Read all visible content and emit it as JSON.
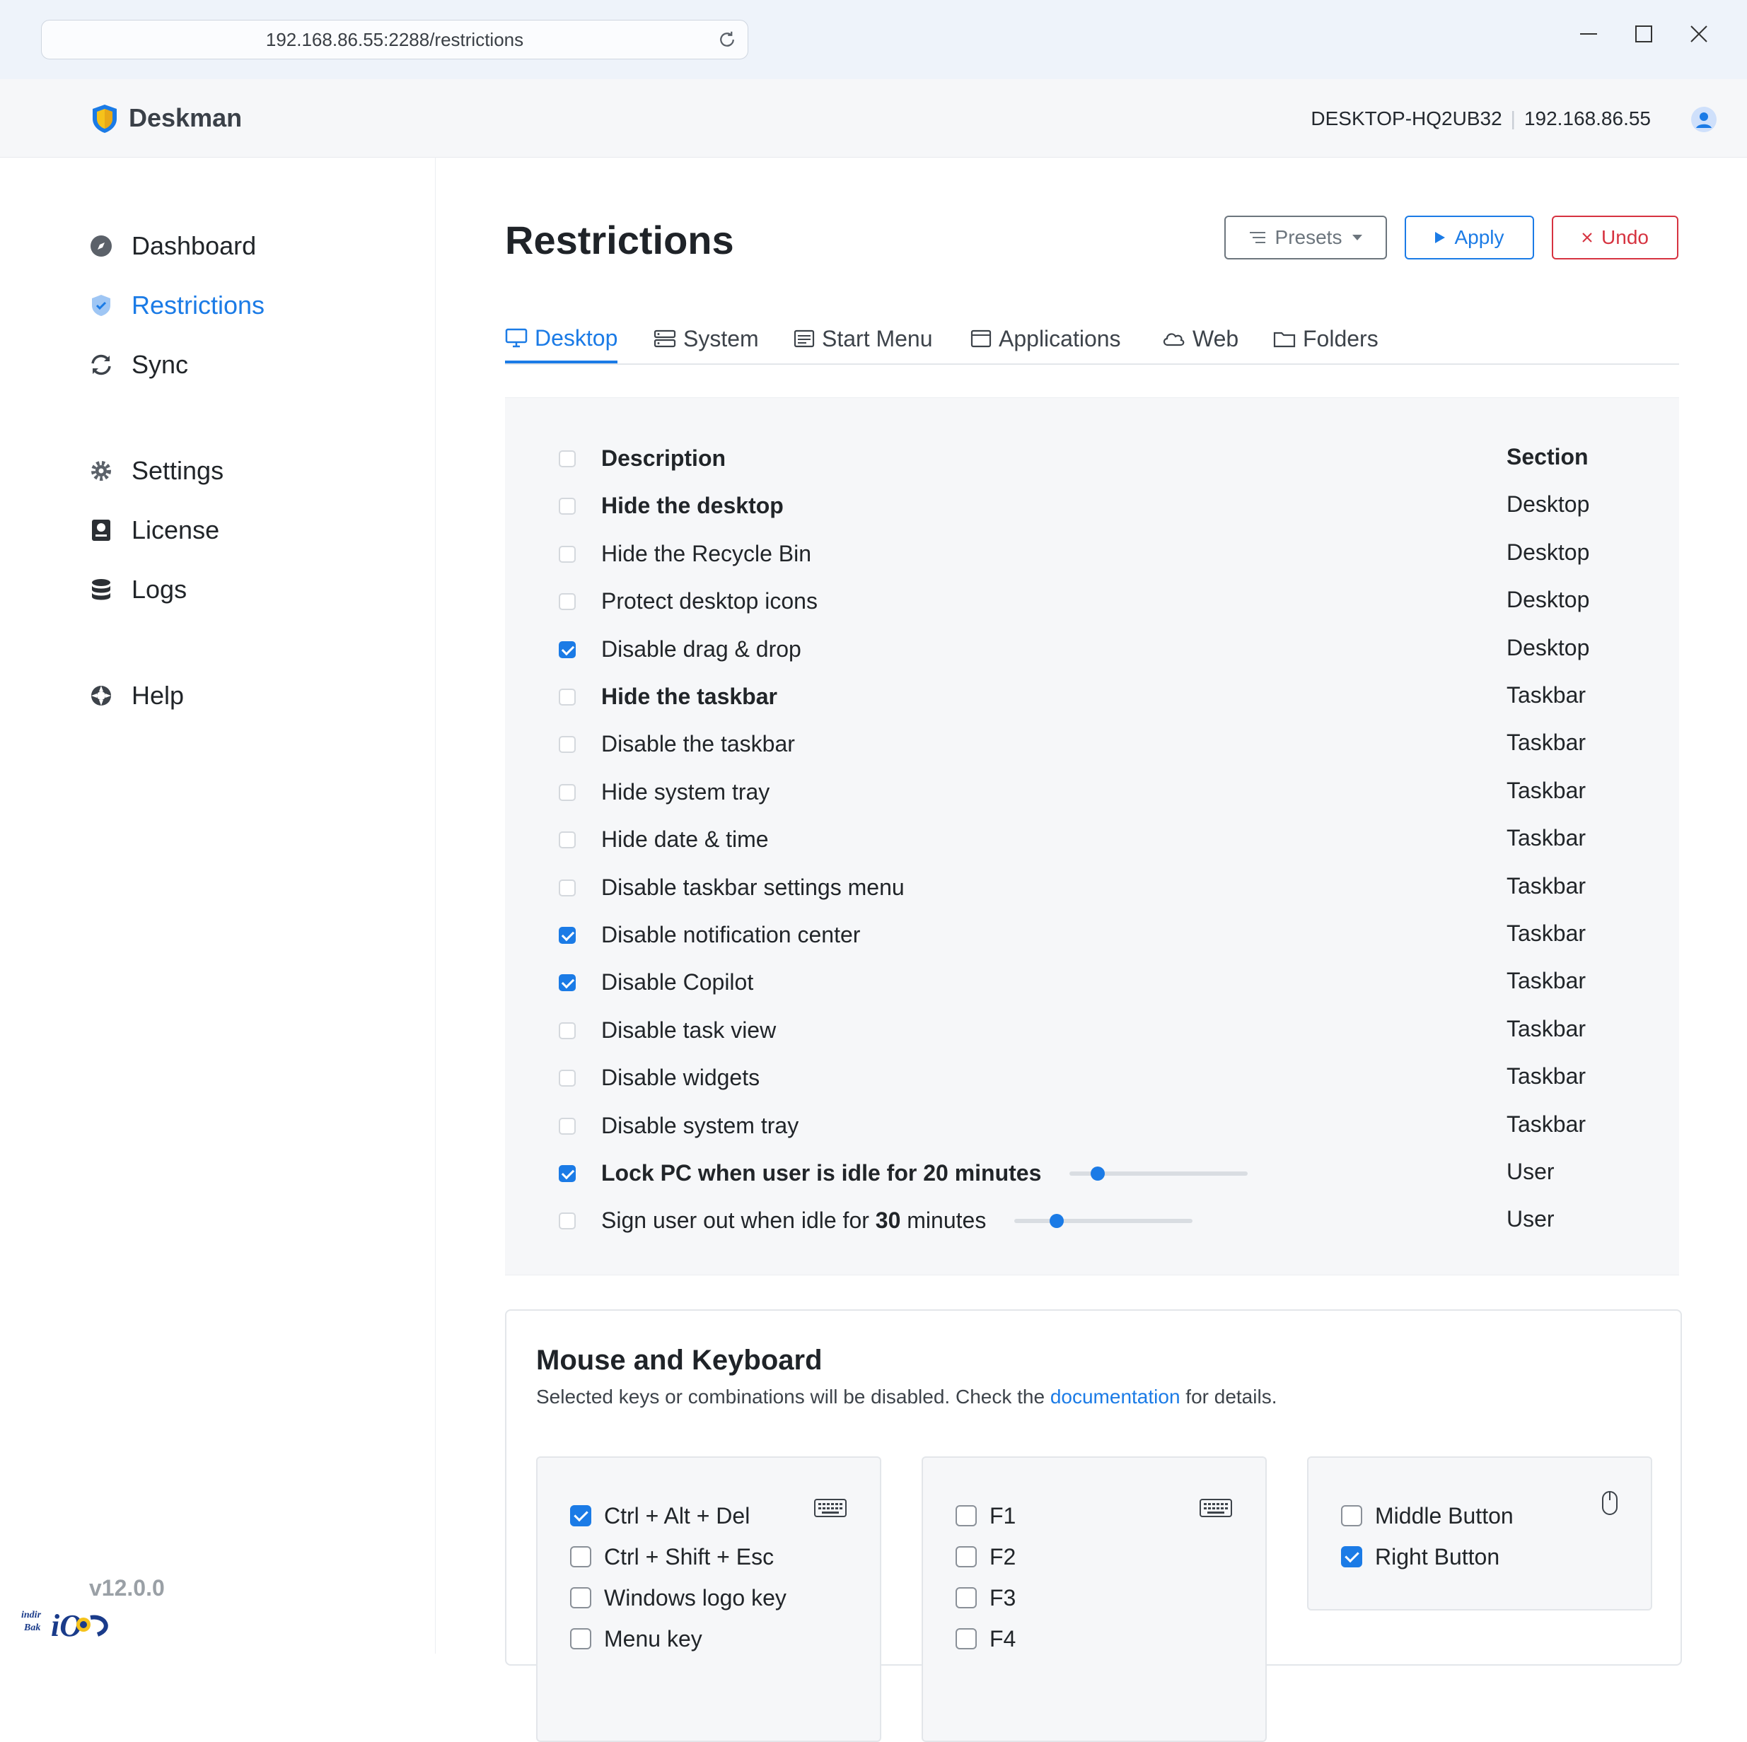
{
  "browser": {
    "url": "192.168.86.55:2288/restrictions"
  },
  "header": {
    "brand": "Deskman",
    "hostname": "DESKTOP-HQ2UB32",
    "ip": "192.168.86.55"
  },
  "sidebar": {
    "items": [
      {
        "label": "Dashboard",
        "icon": "compass-icon"
      },
      {
        "label": "Restrictions",
        "icon": "shield-check-icon",
        "active": true
      },
      {
        "label": "Sync",
        "icon": "sync-icon"
      },
      {
        "label": "Settings",
        "icon": "gear-icon"
      },
      {
        "label": "License",
        "icon": "license-icon"
      },
      {
        "label": "Logs",
        "icon": "database-icon"
      },
      {
        "label": "Help",
        "icon": "lifebuoy-icon"
      }
    ],
    "version": "v12.0.0"
  },
  "page": {
    "title": "Restrictions",
    "presets_label": "Presets",
    "apply_label": "Apply",
    "undo_label": "Undo"
  },
  "tabs": [
    {
      "label": "Desktop",
      "icon": "monitor-icon",
      "active": true
    },
    {
      "label": "System",
      "icon": "server-icon"
    },
    {
      "label": "Start Menu",
      "icon": "menu-window-icon"
    },
    {
      "label": "Applications",
      "icon": "window-icon"
    },
    {
      "label": "Web",
      "icon": "cloud-icon"
    },
    {
      "label": "Folders",
      "icon": "folder-icon"
    }
  ],
  "table": {
    "header": {
      "description": "Description",
      "section": "Section"
    },
    "rows": [
      {
        "description": "Hide the desktop",
        "section": "Desktop",
        "checked": false,
        "bold": true
      },
      {
        "description": "Hide the Recycle Bin",
        "section": "Desktop",
        "checked": false
      },
      {
        "description": "Protect desktop icons",
        "section": "Desktop",
        "checked": false
      },
      {
        "description": "Disable drag & drop",
        "section": "Desktop",
        "checked": true
      },
      {
        "description": "Hide the taskbar",
        "section": "Taskbar",
        "checked": false,
        "bold": true
      },
      {
        "description": "Disable the taskbar",
        "section": "Taskbar",
        "checked": false
      },
      {
        "description": "Hide system tray",
        "section": "Taskbar",
        "checked": false
      },
      {
        "description": "Hide date & time",
        "section": "Taskbar",
        "checked": false
      },
      {
        "description": "Disable taskbar settings menu",
        "section": "Taskbar",
        "checked": false
      },
      {
        "description": "Disable notification center",
        "section": "Taskbar",
        "checked": true
      },
      {
        "description": "Disable Copilot",
        "section": "Taskbar",
        "checked": true
      },
      {
        "description": "Disable task view",
        "section": "Taskbar",
        "checked": false
      },
      {
        "description": "Disable widgets",
        "section": "Taskbar",
        "checked": false
      },
      {
        "description": "Disable system tray",
        "section": "Taskbar",
        "checked": false
      }
    ],
    "idle_rows": [
      {
        "prefix": "Lock PC when user is idle for ",
        "minutes": "20",
        "suffix": " minutes",
        "section": "User",
        "checked": true,
        "bold": true,
        "slider_fraction": 0.16
      },
      {
        "prefix": "Sign user out when idle for ",
        "minutes": "30",
        "suffix": " minutes",
        "section": "User",
        "checked": false,
        "bold": false,
        "slider_fraction": 0.24
      }
    ]
  },
  "mouse_keyboard": {
    "title": "Mouse and Keyboard",
    "subtitle_before": "Selected keys or combinations will be disabled. Check the ",
    "subtitle_link": "documentation",
    "subtitle_after": " for details.",
    "groups": [
      {
        "icon": "keyboard-icon",
        "items": [
          {
            "label": "Ctrl + Alt + Del",
            "checked": true
          },
          {
            "label": "Ctrl + Shift + Esc",
            "checked": false
          },
          {
            "label": "Windows logo key",
            "checked": false
          },
          {
            "label": "Menu key",
            "checked": false
          }
        ]
      },
      {
        "icon": "keyboard-icon",
        "items": [
          {
            "label": "F1",
            "checked": false
          },
          {
            "label": "F2",
            "checked": false
          },
          {
            "label": "F3",
            "checked": false
          },
          {
            "label": "F4",
            "checked": false
          }
        ]
      },
      {
        "icon": "mouse-icon",
        "items": [
          {
            "label": "Middle Button",
            "checked": false
          },
          {
            "label": "Right Button",
            "checked": true
          }
        ]
      }
    ]
  },
  "colors": {
    "accent": "#1b7be6",
    "danger": "#d63340",
    "muted": "#6c757d"
  }
}
